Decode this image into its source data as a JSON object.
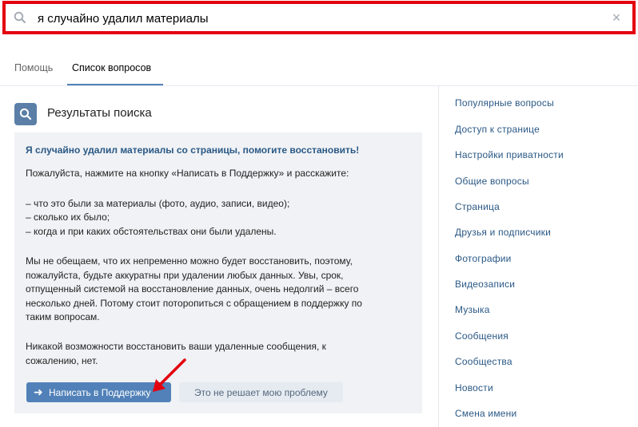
{
  "search": {
    "value": "я случайно удалил материалы",
    "clear_glyph": "×"
  },
  "tabs": [
    {
      "label": "Помощь"
    },
    {
      "label": "Список вопросов"
    }
  ],
  "results": {
    "title": "Результаты поиска"
  },
  "answer": {
    "title": "Я случайно удалил материалы со страницы, помогите восстановить!",
    "lines": [
      "Пожалуйста, нажмите на кнопку «Написать в Поддержку» и расскажите:",
      "– что это были за материалы (фото, аудио, записи, видео);",
      "– сколько их было;",
      "– когда и при каких обстоятельствах они были удалены.",
      "Мы не обещаем, что их непременно можно будет восстановить, поэтому,",
      "пожалуйста, будьте аккуратны при удалении любых данных. Увы, срок,",
      "отпущенный системой на восстановление данных, очень недолгий – всего",
      "несколько дней. Потому стоит поторопиться с обращением в поддержку по",
      "таким вопросам.",
      "Никакой возможности восстановить ваши удаленные сообщения, к",
      "сожалению, нет."
    ],
    "support_button": {
      "arrow": "➜",
      "label": "Написать в Поддержку"
    },
    "other_button": {
      "label": "Это не решает мою проблему"
    }
  },
  "sidebar": {
    "items": [
      {
        "label": "Популярные вопросы"
      },
      {
        "label": "Доступ к странице"
      },
      {
        "label": "Настройки приватности"
      },
      {
        "label": "Общие вопросы"
      },
      {
        "label": "Страница"
      },
      {
        "label": "Друзья и подписчики"
      },
      {
        "label": "Фотографии"
      },
      {
        "label": "Видеозаписи"
      },
      {
        "label": "Музыка"
      },
      {
        "label": "Сообщения"
      },
      {
        "label": "Сообщества"
      },
      {
        "label": "Новости"
      },
      {
        "label": "Смена имени"
      }
    ]
  },
  "colors": {
    "highlight_border": "#e3000f",
    "link": "#2a5885",
    "accent": "#5181b8",
    "card_bg": "#f0f2f5",
    "annotation_arrow": "#e3000f"
  }
}
